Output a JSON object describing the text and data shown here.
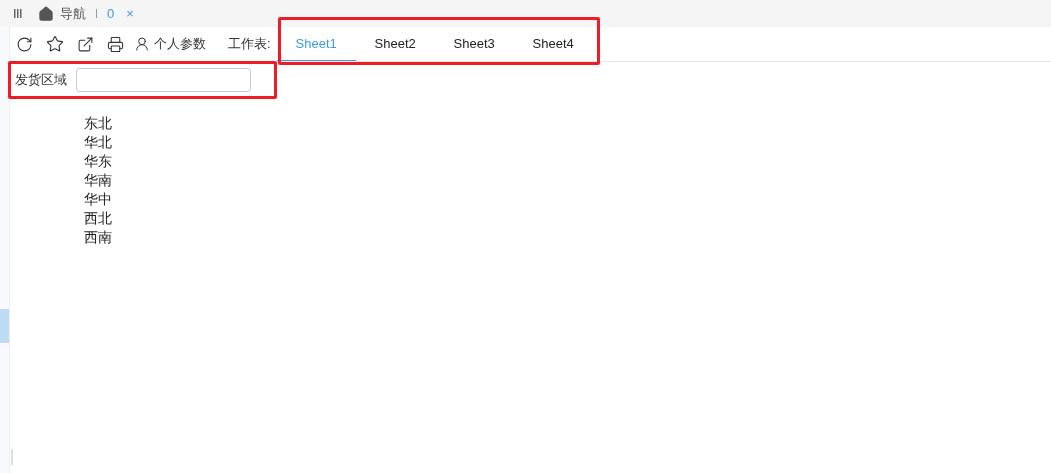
{
  "top_bar": {
    "title": "导航",
    "count": "0",
    "close": "×"
  },
  "toolbar": {
    "personal_params": "个人参数",
    "sheet_label": "工作表:"
  },
  "tabs": [
    {
      "label": "Sheet1",
      "selected": true
    },
    {
      "label": "Sheet2",
      "selected": false
    },
    {
      "label": "Sheet3",
      "selected": false
    },
    {
      "label": "Sheet4",
      "selected": false
    }
  ],
  "filter": {
    "label": "发货区域"
  },
  "regions": [
    "东北",
    "华北",
    "华东",
    "华南",
    "华中",
    "西北",
    "西南"
  ]
}
